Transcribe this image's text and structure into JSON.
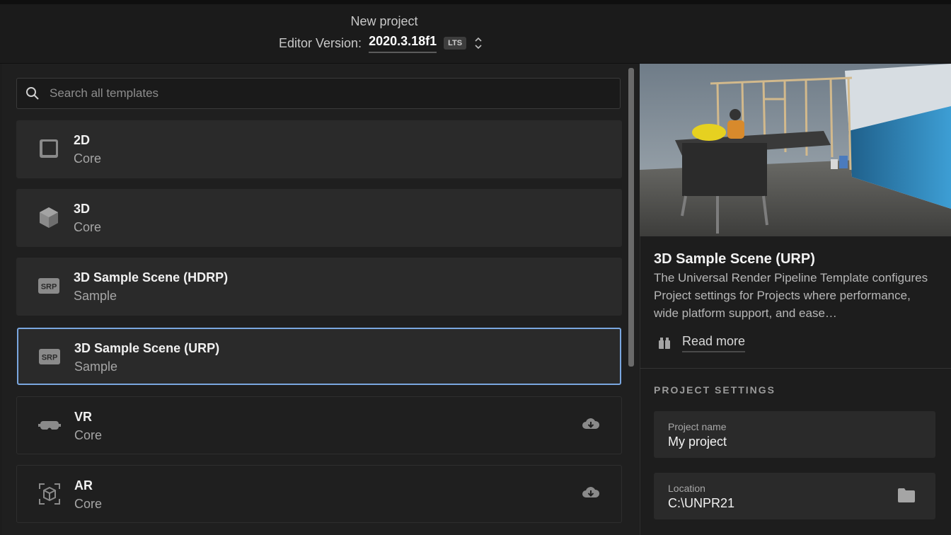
{
  "header": {
    "title": "New project",
    "editor_version_label": "Editor Version:",
    "editor_version_value": "2020.3.18f1",
    "lts_badge": "LTS"
  },
  "search": {
    "placeholder": "Search all templates"
  },
  "templates": [
    {
      "name": "2D",
      "category": "Core",
      "icon": "square-2d-icon"
    },
    {
      "name": "3D",
      "category": "Core",
      "icon": "cube-icon"
    },
    {
      "name": "3D Sample Scene (HDRP)",
      "category": "Sample",
      "icon": "srp-icon",
      "icon_text": "SRP"
    },
    {
      "name": "3D Sample Scene (URP)",
      "category": "Sample",
      "icon": "srp-icon",
      "icon_text": "SRP",
      "selected": true
    },
    {
      "name": "VR",
      "category": "Core",
      "icon": "vr-headset-icon",
      "downloadable": true
    },
    {
      "name": "AR",
      "category": "Core",
      "icon": "ar-cube-icon",
      "downloadable": true
    }
  ],
  "details": {
    "title": "3D Sample Scene (URP)",
    "description": "The Universal Render Pipeline Template configures Project settings for Projects where performance, wide platform support, and ease…",
    "read_more": "Read more"
  },
  "project_settings": {
    "heading": "PROJECT SETTINGS",
    "project_name_label": "Project name",
    "project_name_value": "My project",
    "location_label": "Location",
    "location_value": "C:\\UNPR21"
  },
  "colors": {
    "selected_border": "#7aa7e0",
    "card_bg": "#2a2a2a",
    "panel_bg": "#1d1d1d"
  }
}
